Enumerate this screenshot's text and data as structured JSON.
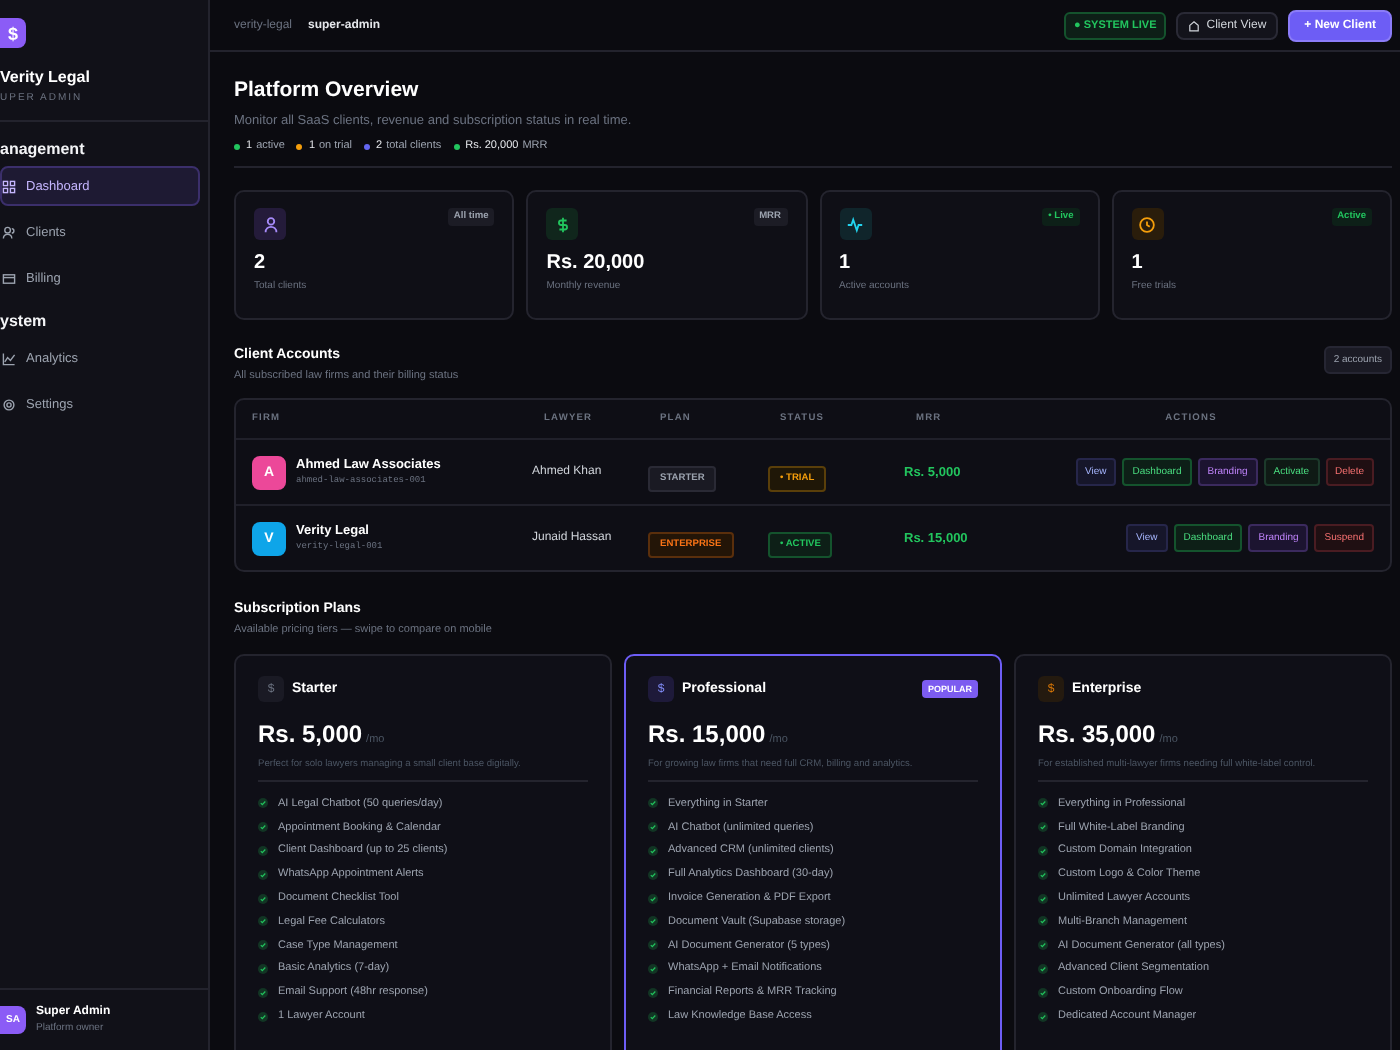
{
  "sidebar": {
    "logo": "$",
    "brand": "Verity Legal",
    "role": "UPER ADMIN",
    "sections": [
      {
        "title": "anagement",
        "items": [
          {
            "label": "Dashboard",
            "kind": "grid",
            "selected": true
          },
          {
            "label": "Clients",
            "kind": "users",
            "selected": false
          },
          {
            "label": "Billing",
            "kind": "card",
            "selected": false
          }
        ]
      },
      {
        "title": "ystem",
        "items": [
          {
            "label": "Analytics",
            "kind": "chart",
            "selected": false
          },
          {
            "label": "Settings",
            "kind": "gear",
            "selected": false
          }
        ]
      }
    ],
    "user": {
      "initials": "SA",
      "name": "Super Admin",
      "role": "Platform owner"
    }
  },
  "topbar": {
    "breadcrumb": [
      "verity-legal",
      "super-admin"
    ],
    "status": "● SYSTEM LIVE",
    "client_view": "Client View",
    "new_client": "+ New Client"
  },
  "overview": {
    "title": "Platform Overview",
    "subtitle": "Monitor all SaaS clients, revenue and subscription status in real time.",
    "stats": [
      {
        "value": "1",
        "label": "active",
        "color": "#22c55e"
      },
      {
        "value": "1",
        "label": "on trial",
        "color": "#f59e0b"
      },
      {
        "value": "2",
        "label": "total clients",
        "color": "#6366f1"
      },
      {
        "value": "Rs. 20,000",
        "label": "MRR",
        "color": "#22c55e"
      }
    ]
  },
  "stat_cards": [
    {
      "kind": "clients",
      "badge": {
        "label": "All time",
        "kind": "neutral"
      },
      "value": "2",
      "label": "Total clients"
    },
    {
      "kind": "revenue",
      "badge": {
        "label": "MRR",
        "kind": "neutral"
      },
      "value": "Rs. 20,000",
      "label": "Monthly revenue"
    },
    {
      "kind": "activity",
      "badge": {
        "label": "• Live",
        "kind": "success"
      },
      "value": "1",
      "label": "Active accounts"
    },
    {
      "kind": "trial",
      "badge": {
        "label": "Active",
        "kind": "success"
      },
      "value": "1",
      "label": "Free trials"
    }
  ],
  "accounts": {
    "title": "Client Accounts",
    "subtitle": "All subscribed law firms and their billing status",
    "count": "2 accounts",
    "columns": [
      "FIRM",
      "LAWYER",
      "PLAN",
      "STATUS",
      "MRR",
      "ACTIONS"
    ],
    "rows": [
      {
        "initial": "A",
        "color": "#ec4899",
        "name": "Ahmed Law Associates",
        "slug": "ahmed-law-associates-001",
        "lawyer": "Ahmed Khan",
        "plan": {
          "label": "STARTER",
          "kind": "starter"
        },
        "status": {
          "label": "• TRIAL",
          "kind": "trial"
        },
        "mrr": "Rs. 5,000",
        "actions": [
          {
            "label": "View",
            "kind": "view"
          },
          {
            "label": "Dashboard",
            "kind": "dashboard"
          },
          {
            "label": "Branding",
            "kind": "branding"
          },
          {
            "label": "Activate",
            "kind": "activate"
          },
          {
            "label": "Delete",
            "kind": "danger"
          }
        ]
      },
      {
        "initial": "V",
        "color": "#0ea5e9",
        "name": "Verity Legal",
        "slug": "verity-legal-001",
        "lawyer": "Junaid Hassan",
        "plan": {
          "label": "ENTERPRISE",
          "kind": "enterprise"
        },
        "status": {
          "label": "• ACTIVE",
          "kind": "active"
        },
        "mrr": "Rs. 15,000",
        "actions": [
          {
            "label": "View",
            "kind": "view"
          },
          {
            "label": "Dashboard",
            "kind": "dashboard"
          },
          {
            "label": "Branding",
            "kind": "branding"
          },
          {
            "label": "Suspend",
            "kind": "danger"
          }
        ]
      }
    ]
  },
  "plans": {
    "title": "Subscription Plans",
    "subtitle": "Available pricing tiers — swipe to compare on mobile",
    "items": [
      {
        "kind": "starter",
        "icon": "$",
        "name": "Starter",
        "price": "Rs. 5,000",
        "period": "/mo",
        "description": "Perfect for solo lawyers managing a small client base digitally.",
        "featured": false,
        "features": [
          "AI Legal Chatbot (50 queries/day)",
          "Appointment Booking & Calendar",
          "Client Dashboard (up to 25 clients)",
          "WhatsApp Appointment Alerts",
          "Document Checklist Tool",
          "Legal Fee Calculators",
          "Case Type Management",
          "Basic Analytics (7-day)",
          "Email Support (48hr response)",
          "1 Lawyer Account"
        ]
      },
      {
        "kind": "professional",
        "icon": "$",
        "name": "Professional",
        "badge": "POPULAR",
        "price": "Rs. 15,000",
        "period": "/mo",
        "description": "For growing law firms that need full CRM, billing and analytics.",
        "featured": true,
        "features": [
          "Everything in Starter",
          "AI Chatbot (unlimited queries)",
          "Advanced CRM (unlimited clients)",
          "Full Analytics Dashboard (30-day)",
          "Invoice Generation & PDF Export",
          "Document Vault (Supabase storage)",
          "AI Document Generator (5 types)",
          "WhatsApp + Email Notifications",
          "Financial Reports & MRR Tracking",
          "Law Knowledge Base Access"
        ]
      },
      {
        "kind": "enterprise",
        "icon": "$",
        "name": "Enterprise",
        "price": "Rs. 35,000",
        "period": "/mo",
        "description": "For established multi-lawyer firms needing full white-label control.",
        "featured": false,
        "features": [
          "Everything in Professional",
          "Full White-Label Branding",
          "Custom Domain Integration",
          "Custom Logo & Color Theme",
          "Unlimited Lawyer Accounts",
          "Multi-Branch Management",
          "AI Document Generator (all types)",
          "Advanced Client Segmentation",
          "Custom Onboarding Flow",
          "Dedicated Account Manager"
        ]
      }
    ]
  }
}
